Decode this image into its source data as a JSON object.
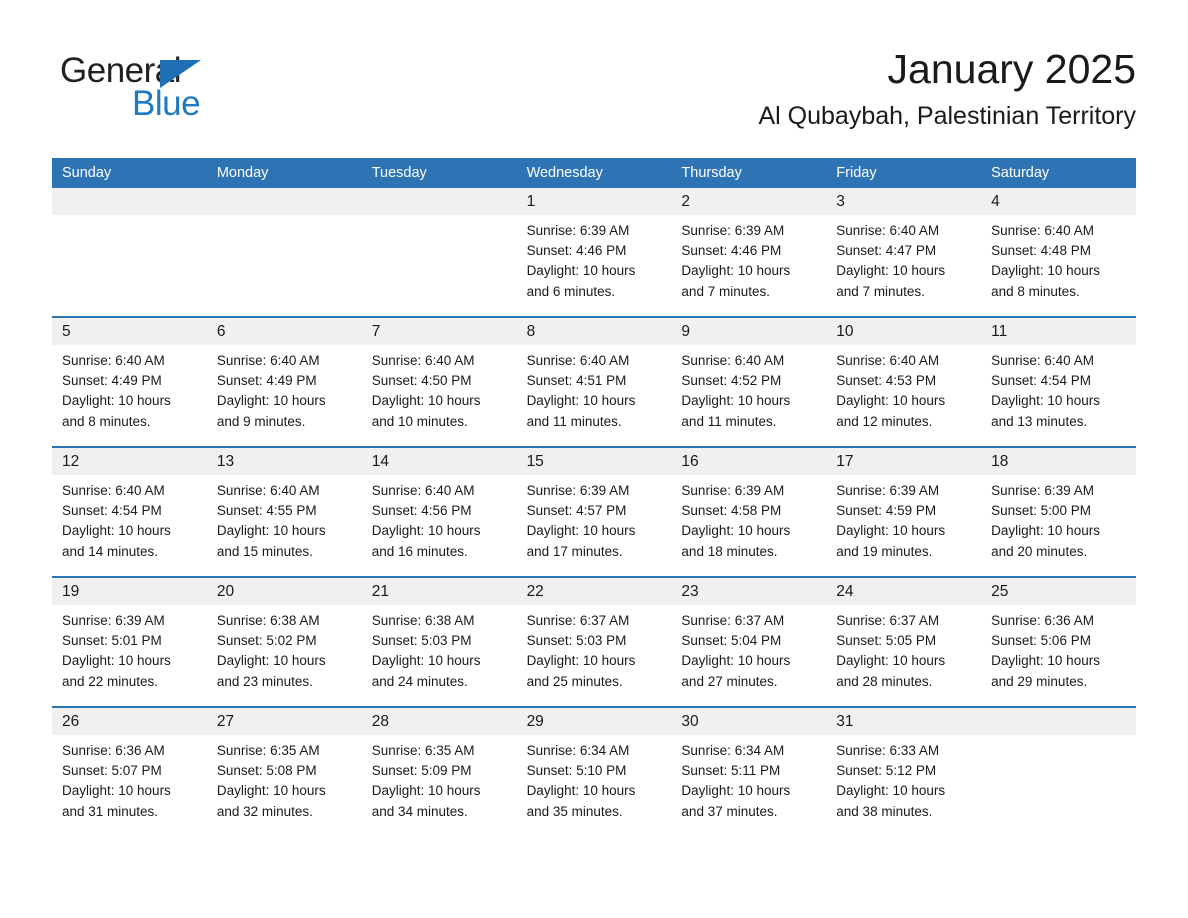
{
  "brand": {
    "line1": "General",
    "line2": "Blue",
    "triangle_color": "#1f6fb4",
    "text_color": "#231f20",
    "blue_text_color": "#1f7ac4"
  },
  "header": {
    "title": "January 2025",
    "subtitle": "Al Qubaybah, Palestinian Territory"
  },
  "theme": {
    "header_blue": "#2e74b5",
    "daynum_band": "#f0f0f0",
    "text": "#1a1a1a",
    "page_background": "#ffffff"
  },
  "weekdays": [
    "Sunday",
    "Monday",
    "Tuesday",
    "Wednesday",
    "Thursday",
    "Friday",
    "Saturday"
  ],
  "weeks": [
    [
      {
        "day": "",
        "lines": []
      },
      {
        "day": "",
        "lines": []
      },
      {
        "day": "",
        "lines": []
      },
      {
        "day": "1",
        "lines": [
          "Sunrise: 6:39 AM",
          "Sunset: 4:46 PM",
          "Daylight: 10 hours",
          "and 6 minutes."
        ]
      },
      {
        "day": "2",
        "lines": [
          "Sunrise: 6:39 AM",
          "Sunset: 4:46 PM",
          "Daylight: 10 hours",
          "and 7 minutes."
        ]
      },
      {
        "day": "3",
        "lines": [
          "Sunrise: 6:40 AM",
          "Sunset: 4:47 PM",
          "Daylight: 10 hours",
          "and 7 minutes."
        ]
      },
      {
        "day": "4",
        "lines": [
          "Sunrise: 6:40 AM",
          "Sunset: 4:48 PM",
          "Daylight: 10 hours",
          "and 8 minutes."
        ]
      }
    ],
    [
      {
        "day": "5",
        "lines": [
          "Sunrise: 6:40 AM",
          "Sunset: 4:49 PM",
          "Daylight: 10 hours",
          "and 8 minutes."
        ]
      },
      {
        "day": "6",
        "lines": [
          "Sunrise: 6:40 AM",
          "Sunset: 4:49 PM",
          "Daylight: 10 hours",
          "and 9 minutes."
        ]
      },
      {
        "day": "7",
        "lines": [
          "Sunrise: 6:40 AM",
          "Sunset: 4:50 PM",
          "Daylight: 10 hours",
          "and 10 minutes."
        ]
      },
      {
        "day": "8",
        "lines": [
          "Sunrise: 6:40 AM",
          "Sunset: 4:51 PM",
          "Daylight: 10 hours",
          "and 11 minutes."
        ]
      },
      {
        "day": "9",
        "lines": [
          "Sunrise: 6:40 AM",
          "Sunset: 4:52 PM",
          "Daylight: 10 hours",
          "and 11 minutes."
        ]
      },
      {
        "day": "10",
        "lines": [
          "Sunrise: 6:40 AM",
          "Sunset: 4:53 PM",
          "Daylight: 10 hours",
          "and 12 minutes."
        ]
      },
      {
        "day": "11",
        "lines": [
          "Sunrise: 6:40 AM",
          "Sunset: 4:54 PM",
          "Daylight: 10 hours",
          "and 13 minutes."
        ]
      }
    ],
    [
      {
        "day": "12",
        "lines": [
          "Sunrise: 6:40 AM",
          "Sunset: 4:54 PM",
          "Daylight: 10 hours",
          "and 14 minutes."
        ]
      },
      {
        "day": "13",
        "lines": [
          "Sunrise: 6:40 AM",
          "Sunset: 4:55 PM",
          "Daylight: 10 hours",
          "and 15 minutes."
        ]
      },
      {
        "day": "14",
        "lines": [
          "Sunrise: 6:40 AM",
          "Sunset: 4:56 PM",
          "Daylight: 10 hours",
          "and 16 minutes."
        ]
      },
      {
        "day": "15",
        "lines": [
          "Sunrise: 6:39 AM",
          "Sunset: 4:57 PM",
          "Daylight: 10 hours",
          "and 17 minutes."
        ]
      },
      {
        "day": "16",
        "lines": [
          "Sunrise: 6:39 AM",
          "Sunset: 4:58 PM",
          "Daylight: 10 hours",
          "and 18 minutes."
        ]
      },
      {
        "day": "17",
        "lines": [
          "Sunrise: 6:39 AM",
          "Sunset: 4:59 PM",
          "Daylight: 10 hours",
          "and 19 minutes."
        ]
      },
      {
        "day": "18",
        "lines": [
          "Sunrise: 6:39 AM",
          "Sunset: 5:00 PM",
          "Daylight: 10 hours",
          "and 20 minutes."
        ]
      }
    ],
    [
      {
        "day": "19",
        "lines": [
          "Sunrise: 6:39 AM",
          "Sunset: 5:01 PM",
          "Daylight: 10 hours",
          "and 22 minutes."
        ]
      },
      {
        "day": "20",
        "lines": [
          "Sunrise: 6:38 AM",
          "Sunset: 5:02 PM",
          "Daylight: 10 hours",
          "and 23 minutes."
        ]
      },
      {
        "day": "21",
        "lines": [
          "Sunrise: 6:38 AM",
          "Sunset: 5:03 PM",
          "Daylight: 10 hours",
          "and 24 minutes."
        ]
      },
      {
        "day": "22",
        "lines": [
          "Sunrise: 6:37 AM",
          "Sunset: 5:03 PM",
          "Daylight: 10 hours",
          "and 25 minutes."
        ]
      },
      {
        "day": "23",
        "lines": [
          "Sunrise: 6:37 AM",
          "Sunset: 5:04 PM",
          "Daylight: 10 hours",
          "and 27 minutes."
        ]
      },
      {
        "day": "24",
        "lines": [
          "Sunrise: 6:37 AM",
          "Sunset: 5:05 PM",
          "Daylight: 10 hours",
          "and 28 minutes."
        ]
      },
      {
        "day": "25",
        "lines": [
          "Sunrise: 6:36 AM",
          "Sunset: 5:06 PM",
          "Daylight: 10 hours",
          "and 29 minutes."
        ]
      }
    ],
    [
      {
        "day": "26",
        "lines": [
          "Sunrise: 6:36 AM",
          "Sunset: 5:07 PM",
          "Daylight: 10 hours",
          "and 31 minutes."
        ]
      },
      {
        "day": "27",
        "lines": [
          "Sunrise: 6:35 AM",
          "Sunset: 5:08 PM",
          "Daylight: 10 hours",
          "and 32 minutes."
        ]
      },
      {
        "day": "28",
        "lines": [
          "Sunrise: 6:35 AM",
          "Sunset: 5:09 PM",
          "Daylight: 10 hours",
          "and 34 minutes."
        ]
      },
      {
        "day": "29",
        "lines": [
          "Sunrise: 6:34 AM",
          "Sunset: 5:10 PM",
          "Daylight: 10 hours",
          "and 35 minutes."
        ]
      },
      {
        "day": "30",
        "lines": [
          "Sunrise: 6:34 AM",
          "Sunset: 5:11 PM",
          "Daylight: 10 hours",
          "and 37 minutes."
        ]
      },
      {
        "day": "31",
        "lines": [
          "Sunrise: 6:33 AM",
          "Sunset: 5:12 PM",
          "Daylight: 10 hours",
          "and 38 minutes."
        ]
      },
      {
        "day": "",
        "lines": []
      }
    ]
  ]
}
